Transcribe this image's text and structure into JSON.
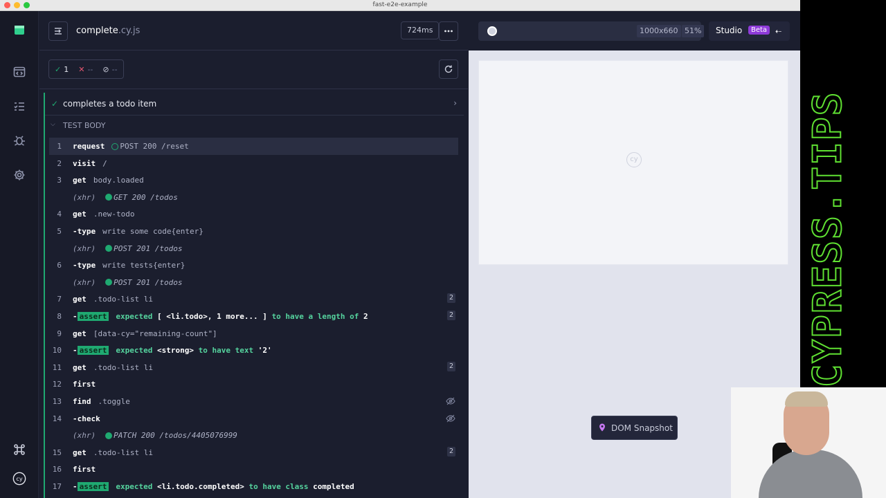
{
  "window": {
    "title": "fast-e2e-example"
  },
  "header": {
    "file_base": "complete",
    "file_ext": ".cy.js",
    "duration": "724ms"
  },
  "stats": {
    "passed": "1",
    "failed": "--",
    "pending": "--"
  },
  "test": {
    "title": "completes a todo item",
    "section": "TEST BODY",
    "commands": [
      {
        "num": "1",
        "name": "request",
        "kind": "req",
        "method": "POST 200 /reset",
        "hollow": true,
        "hl": true
      },
      {
        "num": "2",
        "name": "visit",
        "kind": "plain",
        "msg": "/"
      },
      {
        "num": "3",
        "name": "get",
        "kind": "plain",
        "msg": "body.loaded"
      },
      {
        "num": "",
        "kind": "xhr",
        "xhr": "(xhr)",
        "method": "GET 200 /todos"
      },
      {
        "num": "4",
        "name": "get",
        "kind": "plain",
        "msg": ".new-todo"
      },
      {
        "num": "5",
        "name": "-type",
        "kind": "plain",
        "msg": "write some code{enter}"
      },
      {
        "num": "",
        "kind": "xhr",
        "xhr": "(xhr)",
        "method": "POST 201 /todos"
      },
      {
        "num": "6",
        "name": "-type",
        "kind": "plain",
        "msg": "write tests{enter}"
      },
      {
        "num": "",
        "kind": "xhr",
        "xhr": "(xhr)",
        "method": "POST 201 /todos"
      },
      {
        "num": "7",
        "name": "get",
        "kind": "plain",
        "msg": ".todo-list li",
        "badge": "2"
      },
      {
        "num": "8",
        "kind": "assert",
        "dash": "-",
        "tag": "assert",
        "a1": "expected",
        "a2": "[ <li.todo>, 1 more... ]",
        "a3": "to have a length of",
        "a4": "2",
        "badge": "2"
      },
      {
        "num": "9",
        "name": "get",
        "kind": "plain",
        "msg": "[data-cy=\"remaining-count\"]"
      },
      {
        "num": "10",
        "kind": "assert",
        "dash": "-",
        "tag": "assert",
        "a1": "expected",
        "a2": "<strong>",
        "a3": "to have text",
        "a4": "'2'"
      },
      {
        "num": "11",
        "name": "get",
        "kind": "plain",
        "msg": ".todo-list li",
        "badge": "2"
      },
      {
        "num": "12",
        "name": "first",
        "kind": "plain",
        "msg": ""
      },
      {
        "num": "13",
        "name": "find",
        "kind": "plain",
        "msg": ".toggle",
        "eye": true
      },
      {
        "num": "14",
        "name": "-check",
        "kind": "plain",
        "msg": "",
        "eye": true
      },
      {
        "num": "",
        "kind": "xhr",
        "xhr": "(xhr)",
        "method": "PATCH 200 /todos/4405076999"
      },
      {
        "num": "15",
        "name": "get",
        "kind": "plain",
        "msg": ".todo-list li",
        "badge": "2"
      },
      {
        "num": "16",
        "name": "first",
        "kind": "plain",
        "msg": ""
      },
      {
        "num": "17",
        "kind": "assert",
        "dash": "-",
        "tag": "assert",
        "a1": "expected",
        "a2": "<li.todo.completed>",
        "a3": "to have class",
        "a4": "completed"
      }
    ]
  },
  "aut": {
    "viewport_size": "1000x660",
    "scale": "51%",
    "studio_label": "Studio",
    "beta_label": "Beta",
    "cy_logo": "cy",
    "snapshot_label": "DOM Snapshot"
  },
  "banner": {
    "text": "CYPRESS.TIPS"
  },
  "colors": {
    "pass": "#1fa971",
    "fail": "#e45770",
    "brand_purple": "#8f3bd9",
    "banner_green": "#5fe032"
  },
  "icons": [
    "specs-icon",
    "runs-icon",
    "debug-icon",
    "settings-icon",
    "keyboard-shortcuts-icon",
    "cypress-logo-icon",
    "collapse-icon",
    "more-icon",
    "rerun-icon",
    "eye-slash-icon",
    "pin-icon"
  ]
}
